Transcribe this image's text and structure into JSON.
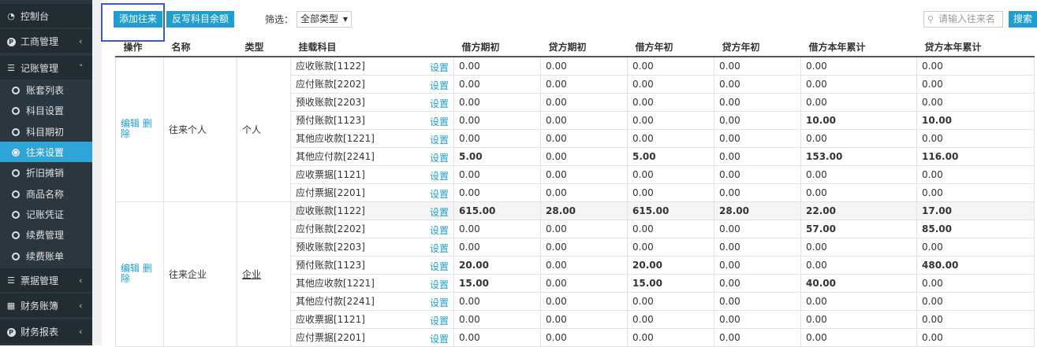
{
  "sidebar": {
    "items": [
      {
        "label": "控制台",
        "kind": "top",
        "icon": "dashboard-icon"
      },
      {
        "label": "工商管理",
        "kind": "top",
        "icon": "p-circle-icon",
        "arrow": "‹"
      },
      {
        "label": "记账管理",
        "kind": "top",
        "icon": "list-icon",
        "arrow": "˅"
      },
      {
        "label": "账套列表",
        "kind": "sub"
      },
      {
        "label": "科目设置",
        "kind": "sub"
      },
      {
        "label": "科目期初",
        "kind": "sub"
      },
      {
        "label": "往来设置",
        "kind": "sub",
        "active": true
      },
      {
        "label": "折旧摊销",
        "kind": "sub"
      },
      {
        "label": "商品名称",
        "kind": "sub"
      },
      {
        "label": "记账凭证",
        "kind": "sub"
      },
      {
        "label": "续费管理",
        "kind": "sub"
      },
      {
        "label": "续费账单",
        "kind": "sub"
      },
      {
        "label": "票据管理",
        "kind": "top",
        "icon": "list-icon",
        "arrow": "‹"
      },
      {
        "label": "财务账簿",
        "kind": "top",
        "icon": "grid-icon",
        "arrow": "‹"
      },
      {
        "label": "财务报表",
        "kind": "top",
        "icon": "p-circle-icon",
        "arrow": "‹"
      }
    ]
  },
  "toolbar": {
    "add_label": "添加往来",
    "writeback_label": "反写科目余额",
    "filter_label": "筛选：",
    "filter_value": "全部类型",
    "search_placeholder": "请输入往来名",
    "search_label": "搜索"
  },
  "table": {
    "headers": [
      "操作",
      "名称",
      "类型",
      "挂载科目",
      "借方期初",
      "贷方期初",
      "借方年初",
      "贷方年初",
      "借方本年累计",
      "贷方本年累计"
    ],
    "edit_label": "编辑",
    "delete_label": "删除",
    "set_label": "设置",
    "groups": [
      {
        "name": "往来个人",
        "type": "个人",
        "rows": [
          {
            "account": "应收账款[1122]",
            "vals": [
              "0.00",
              "0.00",
              "0.00",
              "0.00",
              "0.00",
              "0.00"
            ]
          },
          {
            "account": "应付账款[2202]",
            "vals": [
              "0.00",
              "0.00",
              "0.00",
              "0.00",
              "0.00",
              "0.00"
            ]
          },
          {
            "account": "预收账款[2203]",
            "vals": [
              "0.00",
              "0.00",
              "0.00",
              "0.00",
              "0.00",
              "0.00"
            ]
          },
          {
            "account": "预付账款[1123]",
            "vals": [
              "0.00",
              "0.00",
              "0.00",
              "0.00",
              "10.00",
              "10.00"
            ]
          },
          {
            "account": "其他应收款[1221]",
            "vals": [
              "0.00",
              "0.00",
              "0.00",
              "0.00",
              "0.00",
              "0.00"
            ]
          },
          {
            "account": "其他应付款[2241]",
            "vals": [
              "5.00",
              "0.00",
              "5.00",
              "0.00",
              "153.00",
              "116.00"
            ]
          },
          {
            "account": "应收票据[1121]",
            "vals": [
              "0.00",
              "0.00",
              "0.00",
              "0.00",
              "0.00",
              "0.00"
            ]
          },
          {
            "account": "应付票据[2201]",
            "vals": [
              "0.00",
              "0.00",
              "0.00",
              "0.00",
              "0.00",
              "0.00"
            ]
          }
        ]
      },
      {
        "name": "往来企业",
        "type": "企业",
        "rows": [
          {
            "account": "应收账款[1122]",
            "vals": [
              "615.00",
              "28.00",
              "615.00",
              "28.00",
              "22.00",
              "17.00"
            ]
          },
          {
            "account": "应付账款[2202]",
            "vals": [
              "0.00",
              "0.00",
              "0.00",
              "0.00",
              "57.00",
              "85.00"
            ]
          },
          {
            "account": "预收账款[2203]",
            "vals": [
              "0.00",
              "0.00",
              "0.00",
              "0.00",
              "0.00",
              "0.00"
            ]
          },
          {
            "account": "预付账款[1123]",
            "vals": [
              "20.00",
              "0.00",
              "20.00",
              "0.00",
              "0.00",
              "480.00"
            ]
          },
          {
            "account": "其他应收款[1221]",
            "vals": [
              "15.00",
              "0.00",
              "15.00",
              "0.00",
              "40.00",
              "0.00"
            ]
          },
          {
            "account": "其他应付款[2241]",
            "vals": [
              "0.00",
              "0.00",
              "0.00",
              "0.00",
              "0.00",
              "0.00"
            ]
          },
          {
            "account": "应收票据[1121]",
            "vals": [
              "0.00",
              "0.00",
              "0.00",
              "0.00",
              "0.00",
              "0.00"
            ]
          },
          {
            "account": "应付票据[2201]",
            "vals": [
              "0.00",
              "0.00",
              "0.00",
              "0.00",
              "0.00",
              "0.00"
            ]
          }
        ]
      }
    ]
  }
}
